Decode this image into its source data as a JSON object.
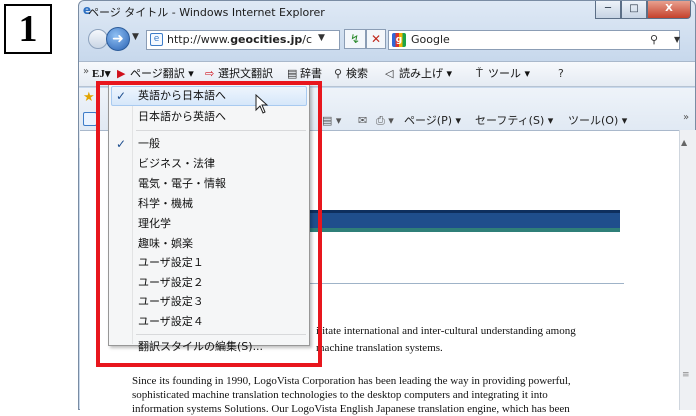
{
  "step": {
    "number": "1"
  },
  "window": {
    "title": "ページ タイトル - Windows Internet Explorer",
    "controls": {
      "minimize": "─",
      "maximize": "□",
      "close": "X"
    }
  },
  "address_bar": {
    "url_prefix": "http://www.",
    "url_domain": "geocities.jp",
    "url_suffix": "/c",
    "search_engine": "Google"
  },
  "toolbar": {
    "brand": "EJ▾",
    "page_translate": "ページ翻訳 ▾",
    "selection_translate": "選択文翻訳",
    "dictionary": "辞書",
    "search": "検索",
    "read_aloud": "読み上げ ▾",
    "tools": "ツール ▾"
  },
  "command_bar": {
    "page": "ページ(P) ▾",
    "safety": "セーフティ(S) ▾",
    "tools": "ツール(O) ▾"
  },
  "menu": {
    "items": [
      {
        "label": "英語から日本語へ",
        "checked": true,
        "highlighted": true
      },
      {
        "label": "日本語から英語へ",
        "checked": false
      },
      {
        "label": "一般",
        "checked": true
      },
      {
        "label": "ビジネス・法律",
        "checked": false
      },
      {
        "label": "電気・電子・情報",
        "checked": false
      },
      {
        "label": "科学・機械",
        "checked": false
      },
      {
        "label": "理化学",
        "checked": false
      },
      {
        "label": "趣味・娯楽",
        "checked": false
      },
      {
        "label": "ユーザ設定１",
        "checked": false
      },
      {
        "label": "ユーザ設定２",
        "checked": false
      },
      {
        "label": "ユーザ設定３",
        "checked": false
      },
      {
        "label": "ユーザ設定４",
        "checked": false
      },
      {
        "label": "翻訳スタイルの編集(S)...",
        "checked": false
      }
    ],
    "check_glyph": "✓"
  },
  "page_content": {
    "line1_fragment": "ilitate international and inter-cultural understanding among",
    "line2_fragment": "machine translation systems.",
    "para_line1": "Since its founding in 1990, LogoVista Corporation has been leading the way in providing powerful,",
    "para_line2": "sophisticated machine translation technologies to the desktop computers and integrating it into",
    "para_line3": "information systems Solutions. Our LogoVista English Japanese translation engine, which has been"
  },
  "colors": {
    "highlight_border": "#e8161d",
    "banner": "#1f4e8c",
    "menu_hover": "#d6e7fa"
  }
}
